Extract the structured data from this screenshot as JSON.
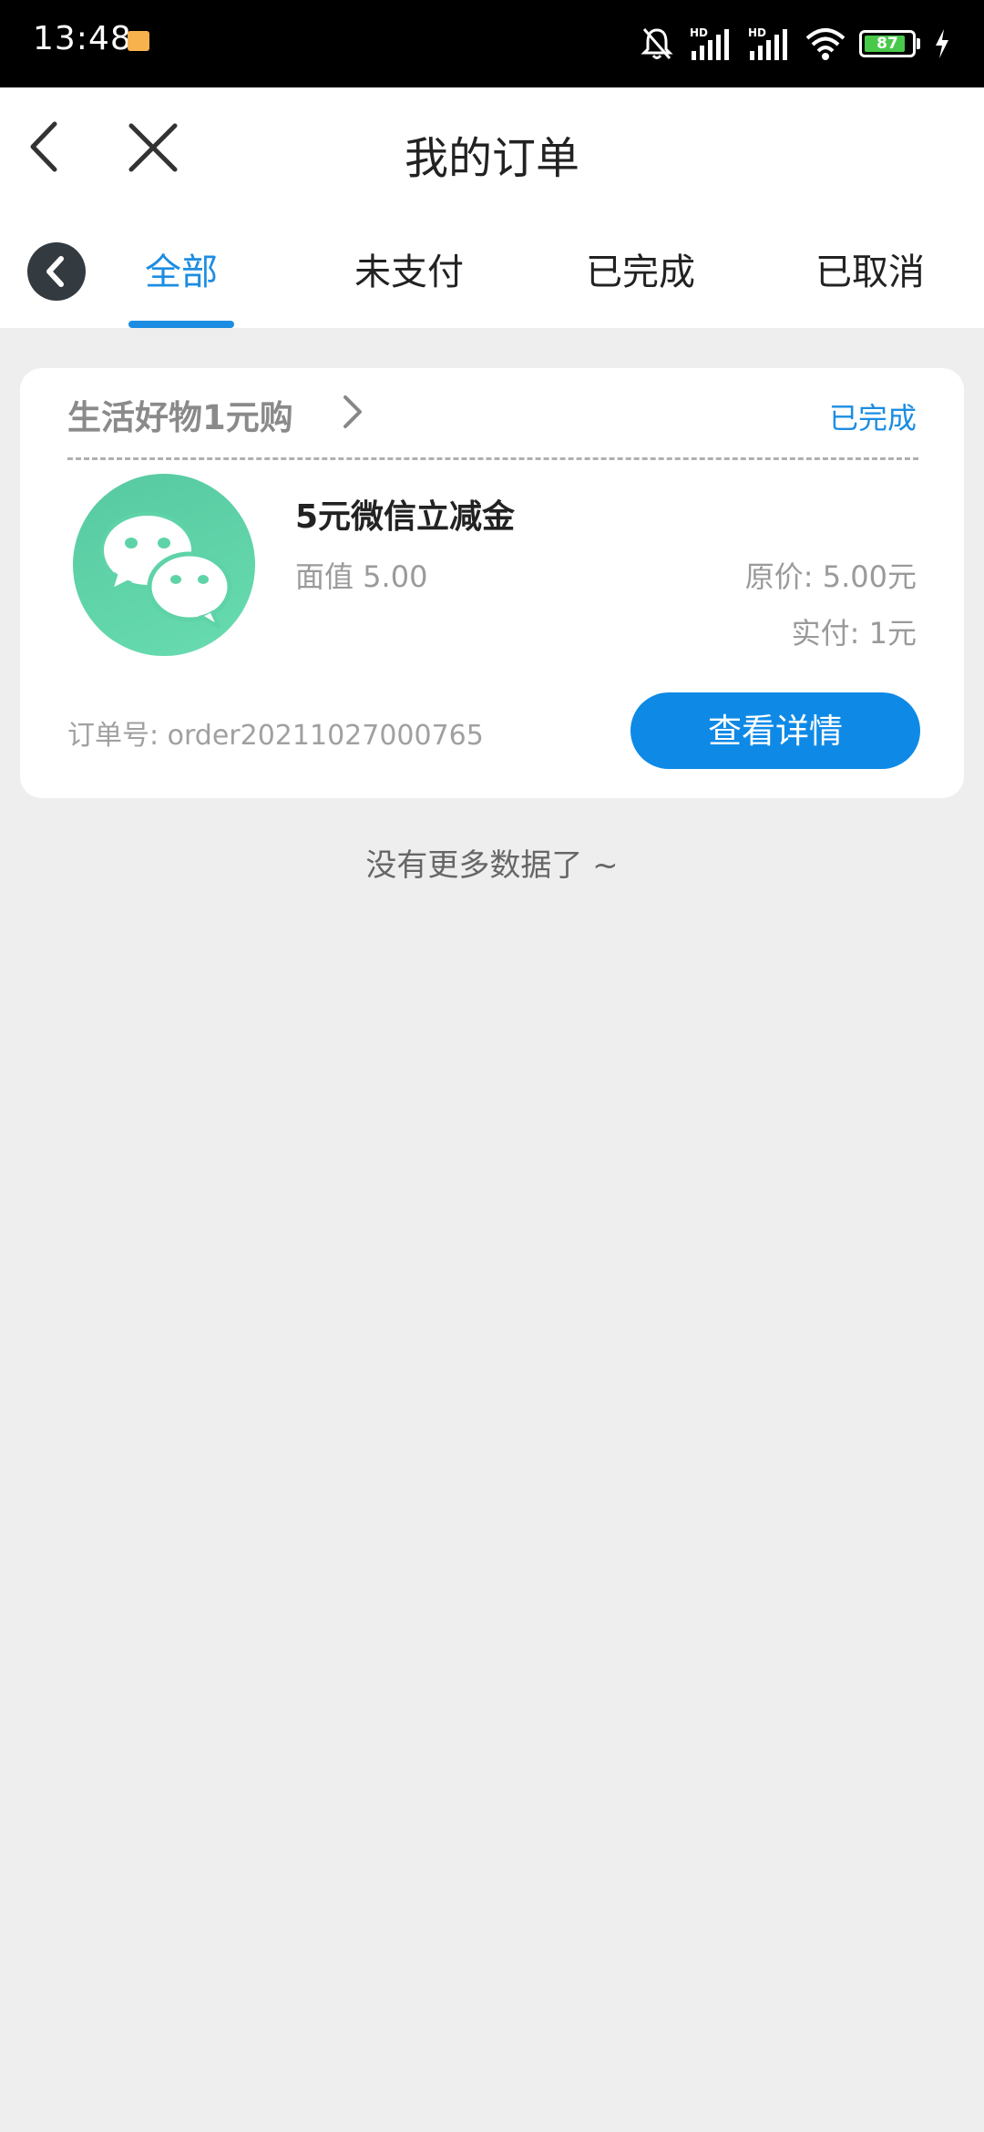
{
  "status_bar": {
    "time": "13:48",
    "battery": "87",
    "battery_level": 0.87,
    "network_badge": "HD"
  },
  "header": {
    "title": "我的订单"
  },
  "tabs": [
    {
      "label": "全部",
      "active": true
    },
    {
      "label": "未支付",
      "active": false
    },
    {
      "label": "已完成",
      "active": false
    },
    {
      "label": "已取消",
      "active": false
    }
  ],
  "order": {
    "shop_name": "生活好物1元购",
    "status": "已完成",
    "product_name": "5元微信立减金",
    "face_value": "面值 5.00",
    "original_price": "原价: 5.00元",
    "paid": "实付: 1元",
    "order_no": "订单号: order20211027000765",
    "details_button": "查看详情",
    "product_icon": "wechat-icon"
  },
  "footer_text": "没有更多数据了 ~",
  "colors": {
    "accent": "#1c8de2",
    "button": "#0e8ae6",
    "wechat_green": "#5fd3a8",
    "background": "#eeeeee"
  }
}
